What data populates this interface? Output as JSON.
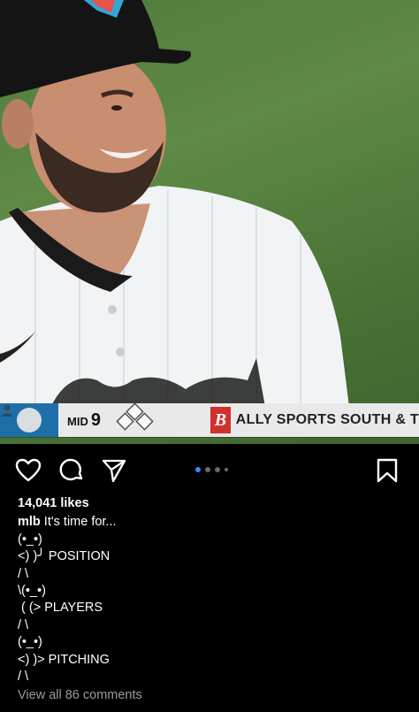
{
  "scoreboard": {
    "inning_prefix": "MID",
    "inning_number": "9",
    "broadcaster_logo_letter": "B",
    "broadcaster_name": "ALLY SPORTS SOUTH & T"
  },
  "carousel": {
    "total_dots": 4,
    "active_index": 0
  },
  "post": {
    "likes": "14,041 likes",
    "username": "mlb",
    "caption_first": " It's time for...",
    "caption_lines": [
      "(•_•)",
      "<) )╯ POSITION",
      "/ \\",
      "\\(•_•)",
      " ( (> PLAYERS",
      "/ \\",
      "(•_•)",
      "<) )> PITCHING",
      "/ \\"
    ],
    "view_comments": "View all 86 comments"
  },
  "icons": {
    "like": "heart-icon",
    "comment": "comment-icon",
    "share": "send-icon",
    "save": "bookmark-icon"
  },
  "colors": {
    "active_dot": "#3b88f5",
    "broadcaster_red": "#d0312d",
    "team_blue": "#1e6fa8"
  }
}
